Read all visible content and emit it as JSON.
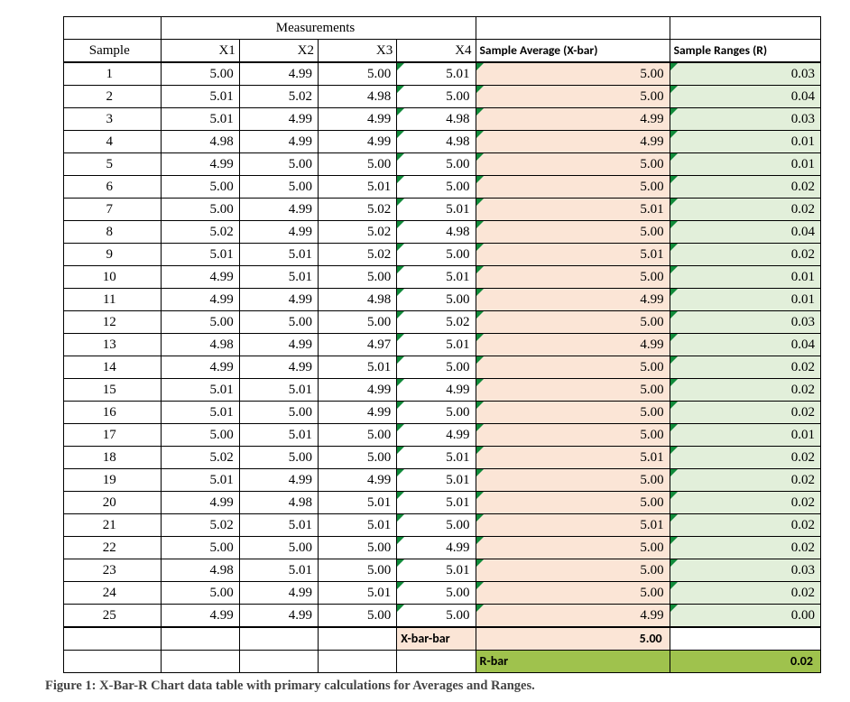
{
  "headers": {
    "measurements": "Measurements",
    "sample": "Sample",
    "x1": "X1",
    "x2": "X2",
    "x3": "X3",
    "x4": "X4",
    "xbar": "Sample Average (X-bar)",
    "range": "Sample Ranges (R)"
  },
  "rows": [
    {
      "sample": "1",
      "x1": "5.00",
      "x2": "4.99",
      "x3": "5.00",
      "x4": "5.01",
      "xbar": "5.00",
      "range": "0.03"
    },
    {
      "sample": "2",
      "x1": "5.01",
      "x2": "5.02",
      "x3": "4.98",
      "x4": "5.00",
      "xbar": "5.00",
      "range": "0.04"
    },
    {
      "sample": "3",
      "x1": "5.01",
      "x2": "4.99",
      "x3": "4.99",
      "x4": "4.98",
      "xbar": "4.99",
      "range": "0.03"
    },
    {
      "sample": "4",
      "x1": "4.98",
      "x2": "4.99",
      "x3": "4.99",
      "x4": "4.98",
      "xbar": "4.99",
      "range": "0.01"
    },
    {
      "sample": "5",
      "x1": "4.99",
      "x2": "5.00",
      "x3": "5.00",
      "x4": "5.00",
      "xbar": "5.00",
      "range": "0.01"
    },
    {
      "sample": "6",
      "x1": "5.00",
      "x2": "5.00",
      "x3": "5.01",
      "x4": "5.00",
      "xbar": "5.00",
      "range": "0.02"
    },
    {
      "sample": "7",
      "x1": "5.00",
      "x2": "4.99",
      "x3": "5.02",
      "x4": "5.01",
      "xbar": "5.01",
      "range": "0.02"
    },
    {
      "sample": "8",
      "x1": "5.02",
      "x2": "4.99",
      "x3": "5.02",
      "x4": "4.98",
      "xbar": "5.00",
      "range": "0.04"
    },
    {
      "sample": "9",
      "x1": "5.01",
      "x2": "5.01",
      "x3": "5.02",
      "x4": "5.00",
      "xbar": "5.01",
      "range": "0.02"
    },
    {
      "sample": "10",
      "x1": "4.99",
      "x2": "5.01",
      "x3": "5.00",
      "x4": "5.01",
      "xbar": "5.00",
      "range": "0.01"
    },
    {
      "sample": "11",
      "x1": "4.99",
      "x2": "4.99",
      "x3": "4.98",
      "x4": "5.00",
      "xbar": "4.99",
      "range": "0.01"
    },
    {
      "sample": "12",
      "x1": "5.00",
      "x2": "5.00",
      "x3": "5.00",
      "x4": "5.02",
      "xbar": "5.00",
      "range": "0.03"
    },
    {
      "sample": "13",
      "x1": "4.98",
      "x2": "4.99",
      "x3": "4.97",
      "x4": "5.01",
      "xbar": "4.99",
      "range": "0.04"
    },
    {
      "sample": "14",
      "x1": "4.99",
      "x2": "4.99",
      "x3": "5.01",
      "x4": "5.00",
      "xbar": "5.00",
      "range": "0.02"
    },
    {
      "sample": "15",
      "x1": "5.01",
      "x2": "5.01",
      "x3": "4.99",
      "x4": "4.99",
      "xbar": "5.00",
      "range": "0.02"
    },
    {
      "sample": "16",
      "x1": "5.01",
      "x2": "5.00",
      "x3": "4.99",
      "x4": "5.00",
      "xbar": "5.00",
      "range": "0.02"
    },
    {
      "sample": "17",
      "x1": "5.00",
      "x2": "5.01",
      "x3": "5.00",
      "x4": "4.99",
      "xbar": "5.00",
      "range": "0.01"
    },
    {
      "sample": "18",
      "x1": "5.02",
      "x2": "5.00",
      "x3": "5.00",
      "x4": "5.01",
      "xbar": "5.01",
      "range": "0.02"
    },
    {
      "sample": "19",
      "x1": "5.01",
      "x2": "4.99",
      "x3": "4.99",
      "x4": "5.01",
      "xbar": "5.00",
      "range": "0.02"
    },
    {
      "sample": "20",
      "x1": "4.99",
      "x2": "4.98",
      "x3": "5.01",
      "x4": "5.01",
      "xbar": "5.00",
      "range": "0.02"
    },
    {
      "sample": "21",
      "x1": "5.02",
      "x2": "5.01",
      "x3": "5.01",
      "x4": "5.00",
      "xbar": "5.01",
      "range": "0.02"
    },
    {
      "sample": "22",
      "x1": "5.00",
      "x2": "5.00",
      "x3": "5.00",
      "x4": "4.99",
      "xbar": "5.00",
      "range": "0.02"
    },
    {
      "sample": "23",
      "x1": "4.98",
      "x2": "5.01",
      "x3": "5.00",
      "x4": "5.01",
      "xbar": "5.00",
      "range": "0.03"
    },
    {
      "sample": "24",
      "x1": "5.00",
      "x2": "4.99",
      "x3": "5.01",
      "x4": "5.00",
      "xbar": "5.00",
      "range": "0.02"
    },
    {
      "sample": "25",
      "x1": "4.99",
      "x2": "4.99",
      "x3": "5.00",
      "x4": "5.00",
      "xbar": "4.99",
      "range": "0.00"
    }
  ],
  "summary": {
    "xbarbar_label": "X-bar-bar",
    "xbarbar_value": "5.00",
    "rbar_label": "R-bar",
    "rbar_value": "0.02"
  },
  "caption": "Figure 1: X-Bar-R Chart data table with primary calculations for Averages and Ranges."
}
